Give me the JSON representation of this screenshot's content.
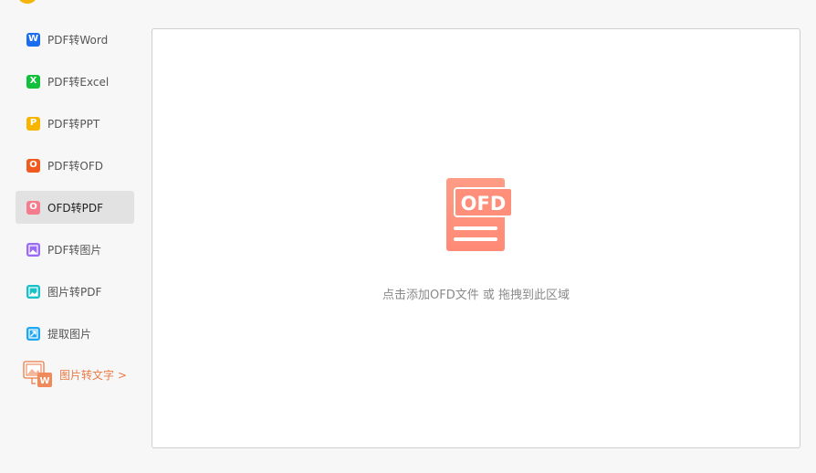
{
  "sidebar": {
    "items": [
      {
        "label": "PDF转Word",
        "icon": "word-icon",
        "color": "#1a6cf0",
        "glyph": "W",
        "active": false
      },
      {
        "label": "PDF转Excel",
        "icon": "excel-icon",
        "color": "#12c13b",
        "glyph": "X",
        "active": false
      },
      {
        "label": "PDF转PPT",
        "icon": "ppt-icon",
        "color": "#f7b500",
        "glyph": "P",
        "active": false
      },
      {
        "label": "PDF转OFD",
        "icon": "ofd-icon",
        "color": "#f05a1f",
        "glyph": "O",
        "active": false
      },
      {
        "label": "OFD转PDF",
        "icon": "pdf-icon",
        "color": "#f47c8c",
        "glyph": "O",
        "active": true
      },
      {
        "label": "PDF转图片",
        "icon": "pdf-to-image-icon",
        "color": "#9a6cf5",
        "glyph": "",
        "active": false
      },
      {
        "label": "图片转PDF",
        "icon": "image-to-pdf-icon",
        "color": "#18c2c8",
        "glyph": "",
        "active": false
      },
      {
        "label": "提取图片",
        "icon": "extract-image-icon",
        "color": "#1ea7f2",
        "glyph": "",
        "active": false
      }
    ],
    "promo": {
      "label": "图片转文字 >",
      "icon": "image-to-text-icon",
      "color": "#e97a45"
    }
  },
  "dropzone": {
    "badge_text": "OFD",
    "hint": "点击添加OFD文件 或 拖拽到此区域",
    "illustration_color": "#ff8e78"
  }
}
